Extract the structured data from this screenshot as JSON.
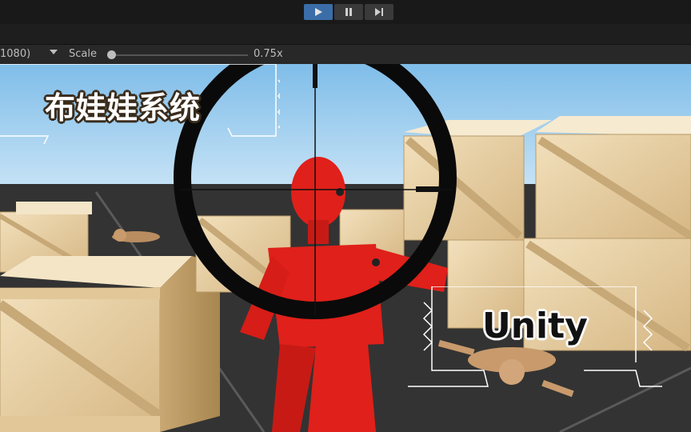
{
  "toolbar": {
    "buttons": [
      {
        "name": "play-button",
        "icon": "play-icon",
        "active": true
      },
      {
        "name": "pause-button",
        "icon": "pause-icon",
        "active": false
      },
      {
        "name": "step-button",
        "icon": "step-icon",
        "active": false
      }
    ]
  },
  "game_view_bar": {
    "resolution_label": "1080)",
    "scale_label": "Scale",
    "scale_value": "0.75x",
    "scale_fraction": 0.0
  },
  "overlay": {
    "title": "布娃娃系统",
    "tag": "Unity"
  },
  "colors": {
    "accent": "#3b6ea8",
    "sky": "#8ec6ee",
    "ground": "#303030",
    "crate": "#e9d3a8",
    "ragdoll_red": "#e0201a",
    "scope_ring": "#0a0a0a"
  }
}
